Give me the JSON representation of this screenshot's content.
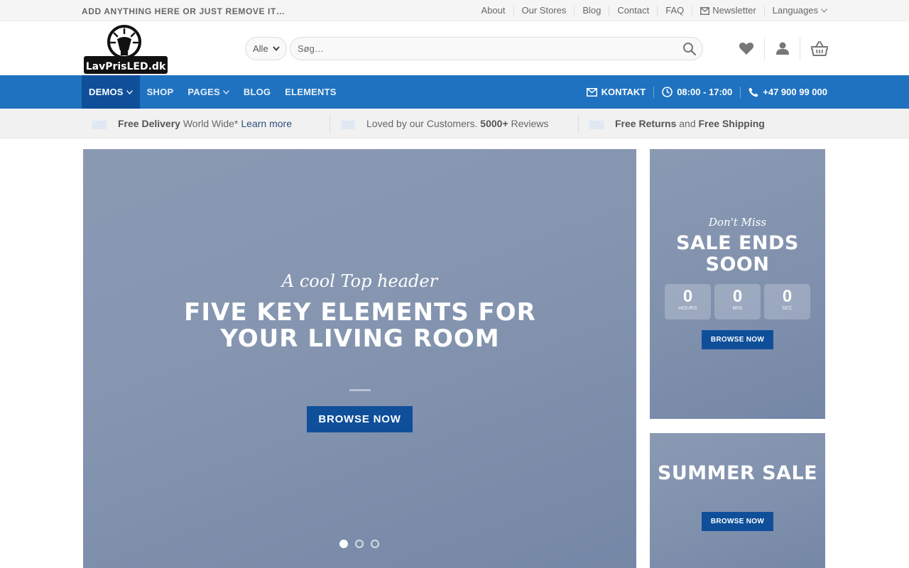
{
  "topbar": {
    "text": "ADD ANYTHING HERE OR JUST REMOVE IT…",
    "links": [
      "About",
      "Our Stores",
      "Blog",
      "Contact",
      "FAQ"
    ],
    "newsletter": "Newsletter",
    "languages": "Languages"
  },
  "header": {
    "logo_text": "LavPrisLED.dk",
    "category_select": "Alle",
    "search_placeholder": "Søg…",
    "icons": [
      "heart-icon",
      "user-icon",
      "basket-icon"
    ]
  },
  "mainnav": {
    "items": [
      "DEMOS",
      "SHOP",
      "PAGES",
      "BLOG",
      "ELEMENTS"
    ],
    "contact": "KONTAKT",
    "hours": "08:00 - 17:00",
    "phone": "+47 900 99 000"
  },
  "strip": {
    "item1": {
      "bold": "Free Delivery",
      "text": "World Wide*",
      "link": "Learn more"
    },
    "item2": {
      "text": "Loved by our Customers.",
      "bold": "5000+",
      "text2": "Reviews"
    },
    "item3": {
      "bold1": "Free Returns",
      "text": "and",
      "bold2": "Free Shipping"
    }
  },
  "hero": {
    "subtitle": "A cool Top header",
    "title": "FIVE KEY ELEMENTS FOR YOUR LIVING ROOM",
    "button": "BROWSE NOW",
    "slides": 3,
    "active_slide": 1
  },
  "banner1": {
    "subtitle": "Don't Miss",
    "title": "SALE ENDS SOON",
    "countdown": [
      {
        "value": "0",
        "label": "HOURS"
      },
      {
        "value": "0",
        "label": "MIN"
      },
      {
        "value": "0",
        "label": "SEC"
      }
    ],
    "button": "BROWSE NOW"
  },
  "banner2": {
    "title": "SUMMER SALE",
    "button": "BROWSE NOW"
  },
  "colors": {
    "primary": "#1f72c0",
    "primary_dark": "#0f4f9a",
    "banner_bg": "#8595b0"
  }
}
